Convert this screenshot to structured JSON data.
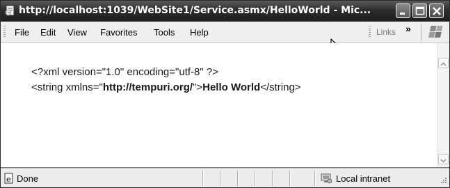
{
  "window": {
    "title": "http://localhost:1039/WebSite1/Service.asmx/HelloWorld - Mic...",
    "buttons": {
      "minimize": "minimize",
      "maximize": "maximize",
      "close": "close"
    }
  },
  "menu": {
    "items": [
      {
        "label": "File"
      },
      {
        "label": "Edit"
      },
      {
        "label": "View"
      },
      {
        "label": "Favorites"
      },
      {
        "label": "Tools"
      },
      {
        "label": "Help"
      }
    ],
    "links_label": "Links",
    "chevron": "»"
  },
  "content": {
    "line1": "<?xml version=\"1.0\" encoding=\"utf-8\" ?>",
    "line2": {
      "open_prefix": "<string xmlns=\"",
      "namespace": "http://tempuri.org/",
      "open_suffix": "\">",
      "value": "Hello World",
      "close_tag": "</string>"
    }
  },
  "status": {
    "text": "Done",
    "zone": "Local intranet"
  },
  "colors": {
    "titlebar": "#2c2c2c",
    "menubar": "#efefef",
    "content_bg": "#ffffff",
    "statusbar": "#ececec"
  },
  "icons": [
    "ie-page-icon",
    "minimize-icon",
    "maximize-icon",
    "close-icon",
    "windows-flag-icon",
    "mouse-pointer-icon",
    "scroll-up-icon",
    "scroll-down-icon",
    "ie-done-icon",
    "local-intranet-icon",
    "resize-grip-icon"
  ]
}
